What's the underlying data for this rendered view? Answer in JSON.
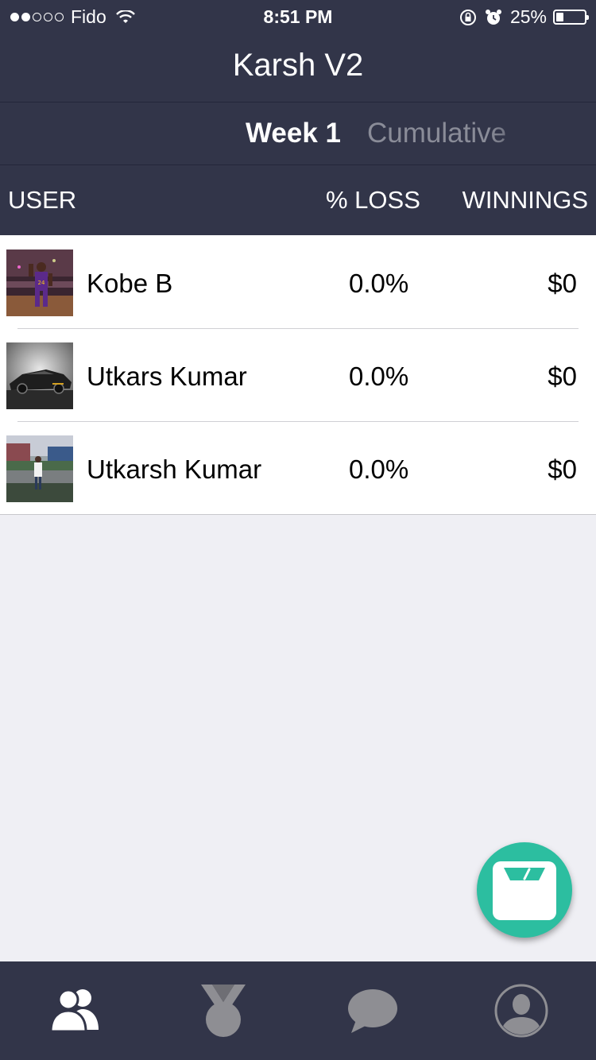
{
  "status_bar": {
    "carrier": "Fido",
    "time": "8:51 PM",
    "battery_text": "25%",
    "battery_level": 0.25,
    "signal_bars": 2,
    "signal_total": 5
  },
  "header": {
    "title": "Karsh V2"
  },
  "segments": {
    "active": "Week 1",
    "inactive": "Cumulative"
  },
  "columns": {
    "user": "USER",
    "loss": "% LOSS",
    "winnings": "WINNINGS"
  },
  "rows": [
    {
      "name": "Kobe B",
      "loss": "0.0%",
      "winnings": "$0",
      "avatar": "basketball-player-photo"
    },
    {
      "name": "Utkars Kumar",
      "loss": "0.0%",
      "winnings": "$0",
      "avatar": "car-photo"
    },
    {
      "name": "Utkarsh Kumar",
      "loss": "0.0%",
      "winnings": "$0",
      "avatar": "person-outdoor-photo"
    }
  ],
  "fab": {
    "icon": "scale-icon",
    "color": "#2cbea0"
  },
  "tab_bar": {
    "items": [
      {
        "icon": "group-icon",
        "active": true
      },
      {
        "icon": "medal-icon",
        "active": false
      },
      {
        "icon": "chat-bubble-icon",
        "active": false
      },
      {
        "icon": "profile-icon",
        "active": false
      }
    ]
  },
  "colors": {
    "header_bg": "#323549",
    "active_tab_icon": "#ffffff",
    "inactive_tab_icon": "#8e8e93",
    "accent": "#2cbea0"
  }
}
